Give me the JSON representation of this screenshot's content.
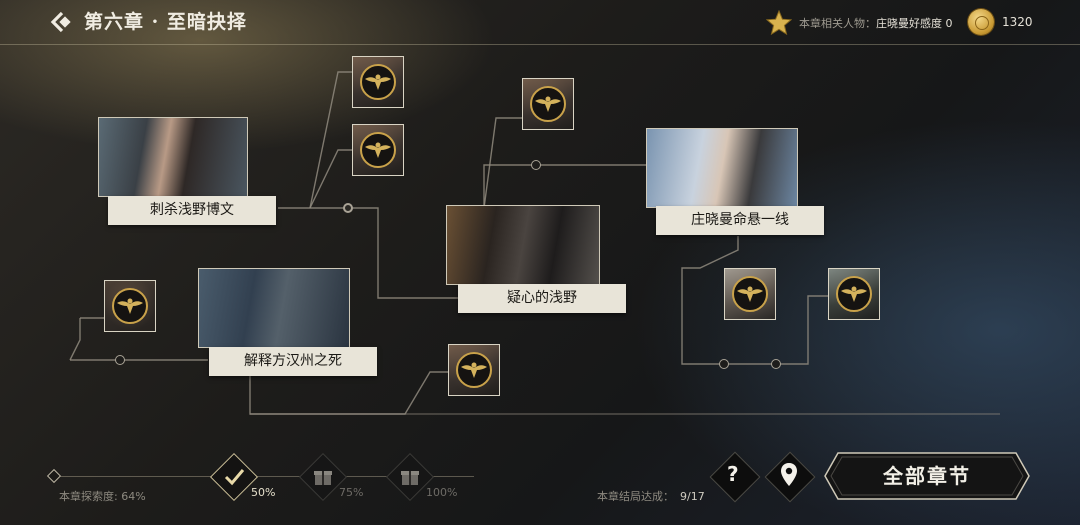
{
  "header": {
    "chapter_title": "第六章 · 至暗抉择",
    "related_label": "本章相关人物：",
    "related_value": "庄晓曼好感度 0",
    "coin_count": "1320",
    "icons": {
      "back": "back-chevron-icon",
      "star": "star-icon",
      "coin": "gold-coin-icon"
    }
  },
  "story_nodes": [
    {
      "label": "刺杀浅野博文"
    },
    {
      "label": "疑心的浅野"
    },
    {
      "label": "庄晓曼命悬一线"
    },
    {
      "label": "解释方汉州之死"
    }
  ],
  "locked_thumb_icon": "eagle-emblem-icon",
  "progress": {
    "explore_label": "本章探索度:",
    "explore_value": "64%",
    "explore_fraction": 0.64,
    "milestones": [
      {
        "label": "50%",
        "state": "claimed",
        "icon": "checkmark-icon"
      },
      {
        "label": "75%",
        "state": "locked",
        "icon": "gift-icon"
      },
      {
        "label": "100%",
        "state": "locked",
        "icon": "gift-icon"
      }
    ],
    "ending_label": "本章结局达成：",
    "ending_value": "9/17"
  },
  "buttons": {
    "help": "?",
    "all_chapters": "全部章节",
    "icons": {
      "help": "question-icon",
      "map": "location-pin-icon"
    }
  },
  "colors": {
    "accent_gold": "#d4b25c",
    "label_bg": "#e8e4d8",
    "line": "#a9a396"
  }
}
